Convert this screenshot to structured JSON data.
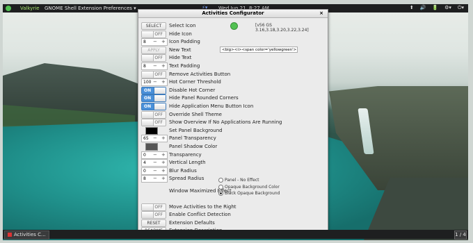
{
  "topbar": {
    "app_name": "Valkyrie",
    "menu": "GNOME Shell Extension Preferences ▾",
    "accessibility": "⚡▾",
    "clock": "Wed Jun 21,  8:27 AM",
    "system_icons": [
      "⬆",
      "🔊",
      "🔋",
      "⚙▾",
      "⏻▾"
    ]
  },
  "dialog": {
    "title": "Activities Configurator",
    "close": "×",
    "rows": [
      {
        "control": "button",
        "value": "SELECT",
        "label": "Select Icon",
        "extra": "version"
      },
      {
        "control": "toggle",
        "value": "OFF",
        "label": "Hide Icon"
      },
      {
        "control": "spin",
        "value": "8",
        "label": "Icon Padding"
      },
      {
        "control": "button",
        "value": "APPLY",
        "disabled": true,
        "label": "New Text",
        "extra": "text"
      },
      {
        "control": "toggle",
        "value": "OFF",
        "label": "Hide Text"
      },
      {
        "control": "spin",
        "value": "8",
        "label": "Text Padding"
      },
      {
        "control": "toggle",
        "value": "OFF",
        "label": "Remove Activities Button"
      },
      {
        "control": "spin",
        "value": "100",
        "label": "Hot Corner Threshold"
      },
      {
        "control": "toggle",
        "value": "ON",
        "label": "Disable Hot Corner"
      },
      {
        "control": "toggle",
        "value": "ON",
        "label": "Hide Panel Rounded Corners"
      },
      {
        "control": "toggle",
        "value": "ON",
        "label": "Hide Application Menu Button Icon"
      },
      {
        "control": "toggle",
        "value": "OFF",
        "label": "Override Shell Theme"
      },
      {
        "control": "toggle",
        "value": "OFF",
        "label": "Show Overview If No Applications Are Running"
      },
      {
        "control": "swatch",
        "color": "#000000",
        "label": "Set Panel Background"
      },
      {
        "control": "spin",
        "value": "65",
        "label": "Panel Transparency"
      },
      {
        "control": "swatch",
        "color": "#555555",
        "label": "Panel Shadow Color"
      },
      {
        "control": "spin",
        "value": "0",
        "label": "Transparency"
      },
      {
        "control": "spin",
        "value": "4",
        "label": "Vertical Length"
      },
      {
        "control": "spin",
        "value": "0",
        "label": "Blur Radius"
      },
      {
        "control": "spin",
        "value": "8",
        "label": "Spread Radius"
      },
      {
        "control": "none",
        "label": "Window Maximized Effect",
        "extra": "radios"
      },
      {
        "control": "toggle",
        "value": "OFF",
        "label": "Move Activities to the Right"
      },
      {
        "control": "toggle",
        "value": "OFF",
        "label": "Enable Conflict Detection"
      },
      {
        "control": "button",
        "value": "RESET",
        "label": "Extension Defaults"
      },
      {
        "control": "button",
        "value": "README",
        "label": "Extension Description"
      }
    ],
    "version_text": "[v56 GS 3.16,3.18,3.20,3.22,3.24]",
    "new_text_value": "<big><i><span color='yellowgreen'> Val",
    "radio_options": [
      {
        "label": "Panel - No Effect",
        "selected": false
      },
      {
        "label": "Opaque Background Color",
        "selected": false
      },
      {
        "label": "Black Opaque Background",
        "selected": true
      }
    ]
  },
  "taskbar": {
    "task_label": "Activities C...",
    "workspace": "1 / 4"
  }
}
